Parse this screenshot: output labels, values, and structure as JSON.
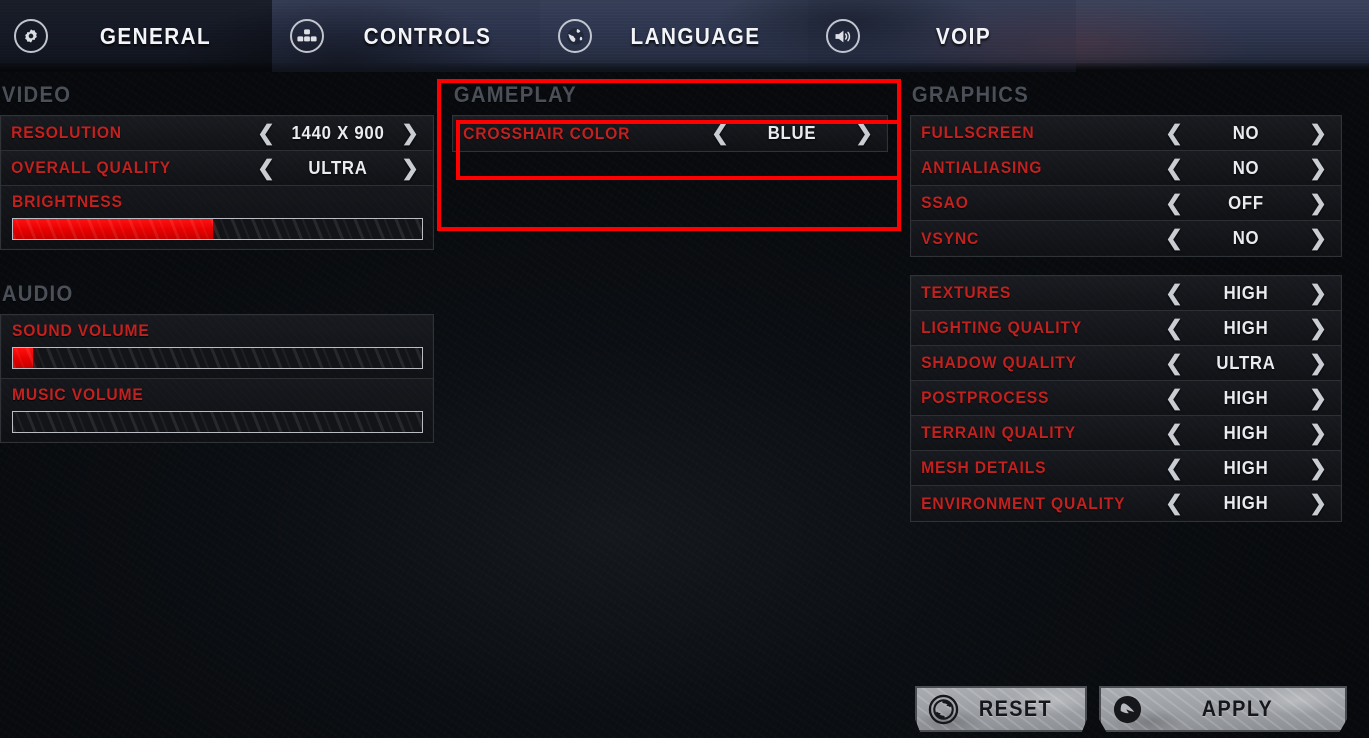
{
  "nav": {
    "tabs": [
      {
        "id": "general",
        "label": "GENERAL",
        "icon": "gear-icon",
        "active": true
      },
      {
        "id": "controls",
        "label": "CONTROLS",
        "icon": "keyboard-icon",
        "active": false
      },
      {
        "id": "language",
        "label": "LANGUAGE",
        "icon": "globe-icon",
        "active": false
      },
      {
        "id": "voip",
        "label": "VOIP",
        "icon": "speaker-icon",
        "active": false
      }
    ]
  },
  "colors": {
    "label_red": "#c1211f",
    "highlight_red": "#ff0000",
    "value_white": "#e9ebef",
    "section_gray": "#4b5058",
    "slider_fill": "#e60000"
  },
  "arrows": {
    "left": "❮",
    "right": "❯"
  },
  "sections": {
    "video": {
      "title": "VIDEO",
      "rows": [
        {
          "label": "RESOLUTION",
          "value": "1440 X 900"
        },
        {
          "label": "OVERALL QUALITY",
          "value": "ULTRA"
        }
      ],
      "sliders": [
        {
          "label": "BRIGHTNESS",
          "percent": 49
        }
      ]
    },
    "audio": {
      "title": "AUDIO",
      "sliders": [
        {
          "label": "SOUND VOLUME",
          "percent": 5
        },
        {
          "label": "MUSIC VOLUME",
          "percent": 0
        }
      ]
    },
    "gameplay": {
      "title": "GAMEPLAY",
      "rows": [
        {
          "label": "CROSSHAIR COLOR",
          "value": "BLUE"
        }
      ]
    },
    "graphics": {
      "title": "GRAPHICS",
      "group1": [
        {
          "label": "FULLSCREEN",
          "value": "NO"
        },
        {
          "label": "ANTIALIASING",
          "value": "NO"
        },
        {
          "label": "SSAO",
          "value": "OFF"
        },
        {
          "label": "VSYNC",
          "value": "NO"
        }
      ],
      "group2": [
        {
          "label": "TEXTURES",
          "value": "HIGH"
        },
        {
          "label": "LIGHTING QUALITY",
          "value": "HIGH"
        },
        {
          "label": "SHADOW QUALITY",
          "value": "ULTRA"
        },
        {
          "label": "POSTPROCESS",
          "value": "HIGH"
        },
        {
          "label": "TERRAIN QUALITY",
          "value": "HIGH"
        },
        {
          "label": "MESH DETAILS",
          "value": "HIGH"
        },
        {
          "label": "ENVIRONMENT QUALITY",
          "value": "HIGH"
        }
      ]
    }
  },
  "buttons": {
    "reset": {
      "label": "RESET",
      "icon": "refresh-icon"
    },
    "apply": {
      "label": "APPLY",
      "icon": "check-arrow-icon"
    }
  }
}
